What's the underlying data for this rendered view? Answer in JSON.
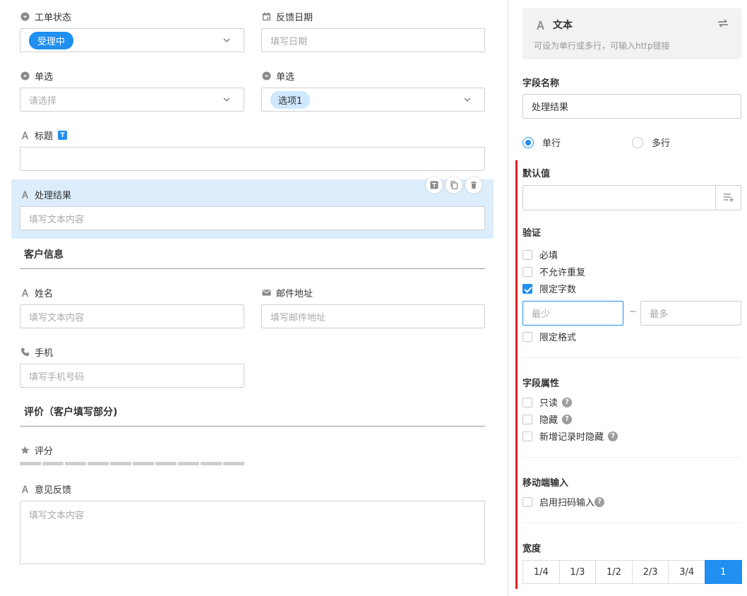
{
  "form": {
    "ticket_status": {
      "label": "工单状态",
      "value": "受理中"
    },
    "feedback_date": {
      "label": "反馈日期",
      "placeholder": "填写日期"
    },
    "single_select_1": {
      "label": "单选",
      "placeholder": "请选择"
    },
    "single_select_2": {
      "label": "单选",
      "value": "选项1"
    },
    "title_field": {
      "label": "标题",
      "badge": "T"
    },
    "result_field": {
      "label": "处理结果",
      "placeholder": "填写文本内容"
    },
    "customer_section": {
      "title": "客户信息"
    },
    "name_field": {
      "label": "姓名",
      "placeholder": "填写文本内容"
    },
    "email_field": {
      "label": "邮件地址",
      "placeholder": "填写邮件地址"
    },
    "phone_field": {
      "label": "手机",
      "placeholder": "填写手机号码"
    },
    "rating_section": {
      "title": "评价（客户填写部分)"
    },
    "rating_field": {
      "label": "评分",
      "max_stars": 10,
      "value": 0
    },
    "feedback_field": {
      "label": "意见反馈",
      "placeholder": "填写文本内容"
    }
  },
  "panel": {
    "type_title": "文本",
    "type_desc": "可设为单行或多行，可输入http链接",
    "field_name_label": "字段名称",
    "field_name_value": "处理结果",
    "single_line": "单行",
    "multi_line": "多行",
    "line_mode": "single",
    "default_label": "默认值",
    "validation_label": "验证",
    "required": "必填",
    "no_duplicate": "不允许重复",
    "limit_chars": "限定字数",
    "min_placeholder": "最少",
    "range_sep": "~",
    "max_placeholder": "最多",
    "limit_format": "限定格式",
    "attr_label": "字段属性",
    "readonly": "只读",
    "hidden": "隐藏",
    "hide_on_new": "新增记录时隐藏",
    "mobile_label": "移动端输入",
    "scan_input": "启用扫码输入",
    "width_label": "宽度",
    "widths": [
      "1/4",
      "1/3",
      "1/2",
      "2/3",
      "3/4",
      "1"
    ],
    "width_selected": "1",
    "help": "?",
    "checked": {
      "limit_chars": true,
      "required": false,
      "no_duplicate": false,
      "limit_format": false,
      "readonly": false,
      "hidden": false,
      "hide_on_new": false,
      "scan_input": false
    }
  },
  "colors": {
    "accent": "#1f8ff0",
    "highlight_bg": "#dcedfc",
    "red_bar": "#e02020"
  }
}
